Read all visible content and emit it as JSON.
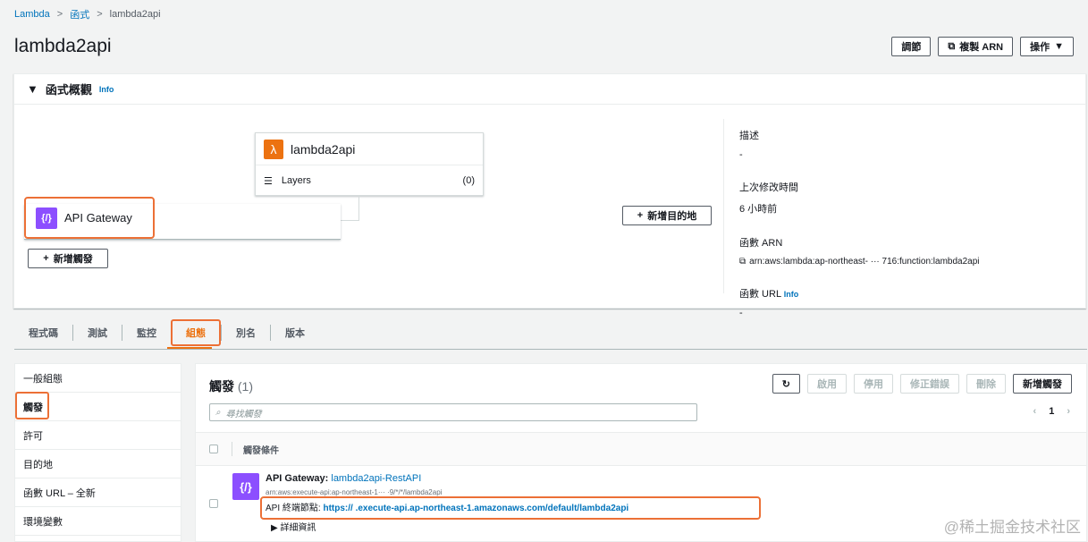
{
  "breadcrumb": {
    "root": "Lambda",
    "section": "函式",
    "current": "lambda2api"
  },
  "page": {
    "title": "lambda2api"
  },
  "header_buttons": {
    "throttle": "調節",
    "copy_arn": "複製 ARN",
    "actions": "操作"
  },
  "overview": {
    "title": "函式概觀",
    "info": "Info",
    "function_name": "lambda2api",
    "layers_label": "Layers",
    "layers_count": "(0)",
    "trigger_name": "API Gateway",
    "add_trigger": "新增觸發",
    "add_destination": "新增目的地",
    "description_label": "描述",
    "description_value": "-",
    "last_modified_label": "上次修改時間",
    "last_modified_value": "6 小時前",
    "arn_label": "函數 ARN",
    "arn_value": "arn:aws:lambda:ap-northeast-  ···  716:function:lambda2api",
    "url_label": "函數 URL",
    "url_info": "Info",
    "url_value": "-"
  },
  "tabs": [
    "程式碼",
    "測試",
    "監控",
    "組態",
    "別名",
    "版本"
  ],
  "active_tab": "組態",
  "sidebar": [
    "一般組態",
    "觸發",
    "許可",
    "目的地",
    "函數 URL – 全新",
    "環境變數"
  ],
  "triggers": {
    "title": "觸發",
    "count": "(1)",
    "buttons": {
      "enable": "啟用",
      "disable": "停用",
      "fix": "修正錯誤",
      "delete": "刪除",
      "add": "新增觸發"
    },
    "search_placeholder": "尋找觸發",
    "page": "1",
    "column": "觸發條件",
    "row": {
      "type": "API Gateway",
      "name": "lambda2api-RestAPI",
      "arn": "arn:aws:execute-api:ap-northeast-1···  ·9/*/*/lambda2api",
      "endpoint_label": "API 終端節點:",
      "endpoint": "https://          .execute-api.ap-northeast-1.amazonaws.com/default/lambda2api",
      "details": "詳細資訊"
    }
  },
  "watermark": "@稀土掘金技术社区",
  "colors": {
    "accent": "#ec7211",
    "link": "#0073bb",
    "highlight": "#ec7036",
    "api_gateway": "#8c4fff"
  }
}
